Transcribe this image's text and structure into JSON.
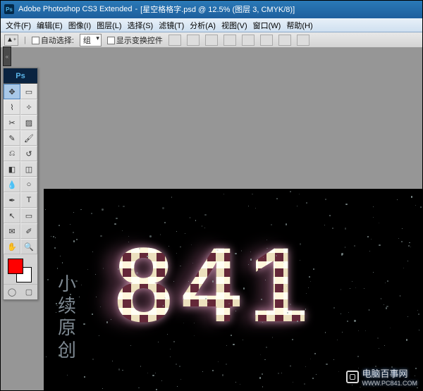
{
  "title": {
    "app": "Adobe Photoshop CS3 Extended",
    "doc": "[星空格格字.psd @ 12.5% (图层 3, CMYK/8)]"
  },
  "menu": {
    "file": "文件(F)",
    "edit": "编辑(E)",
    "image": "图像(I)",
    "layer": "图层(L)",
    "select": "选择(S)",
    "filter": "滤镜(T)",
    "analysis": "分析(A)",
    "view": "视图(V)",
    "window": "窗口(W)",
    "help": "帮助(H)"
  },
  "options": {
    "autoSelectLabel": "自动选择:",
    "autoSelectValue": "组",
    "showTransformLabel": "显示变换控件"
  },
  "toolbox": {
    "psLabel": "Ps"
  },
  "canvas": {
    "bigText": "841",
    "sideText": "小续原创"
  },
  "watermark": {
    "title": "电脑百事网",
    "url": "WWW.PC841.COM"
  },
  "dockTab": "«"
}
